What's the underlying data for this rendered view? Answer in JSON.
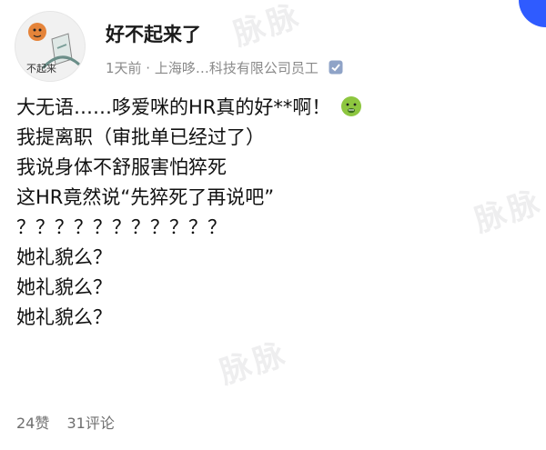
{
  "post": {
    "author": "好不起来了",
    "avatar_text": "不起来",
    "meta": "1天前 · 上海哆…科技有限公司员工",
    "lines": [
      "大无语……哆爱咪的HR真的好**啊！",
      "我提离职（审批单已经过了）",
      "我说身体不舒服害怕猝死",
      "这HR竟然说“先猝死了再说吧”",
      "？？？？？？？？？？？",
      "她礼貌么？",
      "她礼貌么？",
      "她礼貌么？"
    ],
    "likes": "24赞",
    "comments": "31评论"
  },
  "watermark": "脉脉",
  "icons": {
    "verified": "verified-badge-icon",
    "nauseated": "nauseated-face-emoji"
  },
  "colors": {
    "accent": "#2f5bff",
    "meta_gray": "#8a8a8a"
  }
}
